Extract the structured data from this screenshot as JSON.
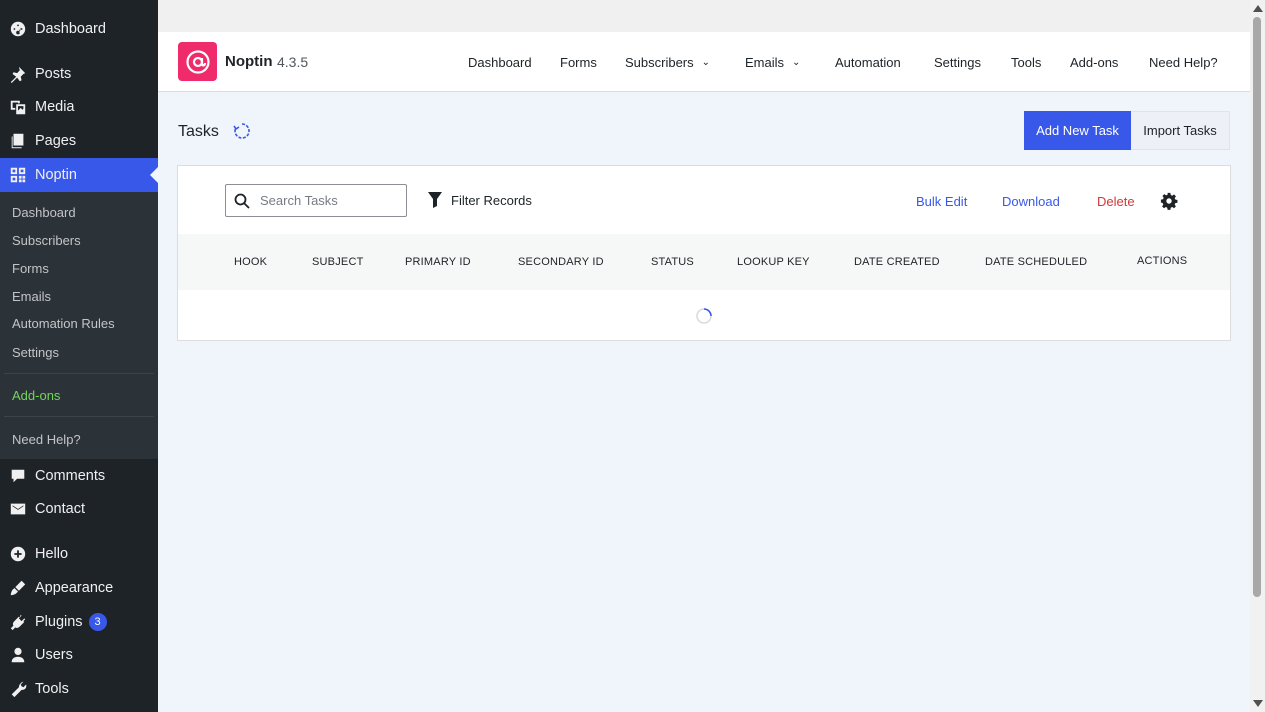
{
  "sidebar": {
    "top_items": [
      {
        "label": "Dashboard",
        "icon": "dashboard-icon"
      },
      {
        "label": "Posts",
        "icon": "pin-icon"
      },
      {
        "label": "Media",
        "icon": "media-icon"
      },
      {
        "label": "Pages",
        "icon": "pages-icon"
      },
      {
        "label": "Noptin",
        "icon": "grid-icon",
        "active": true
      }
    ],
    "submenu": {
      "dashboard": "Dashboard",
      "subscribers": "Subscribers",
      "forms": "Forms",
      "emails": "Emails",
      "automation_rules": "Automation Rules",
      "settings": "Settings",
      "addons": "Add-ons",
      "need_help": "Need Help?"
    },
    "bottom_items": [
      {
        "label": "Comments",
        "icon": "comment-icon"
      },
      {
        "label": "Contact",
        "icon": "mail-icon"
      },
      {
        "label": "Hello",
        "icon": "plus-circle-icon"
      },
      {
        "label": "Appearance",
        "icon": "brush-icon"
      },
      {
        "label": "Plugins",
        "icon": "plugin-icon",
        "badge": "3"
      },
      {
        "label": "Users",
        "icon": "user-icon"
      },
      {
        "label": "Tools",
        "icon": "wrench-icon"
      }
    ]
  },
  "header": {
    "brand": "Noptin",
    "version": "4.3.5",
    "nav": {
      "dashboard": "Dashboard",
      "forms": "Forms",
      "subscribers": "Subscribers",
      "emails": "Emails",
      "automation": "Automation",
      "settings": "Settings",
      "tools": "Tools",
      "addons": "Add-ons",
      "need_help": "Need Help?"
    }
  },
  "page": {
    "title": "Tasks",
    "add_new_label": "Add New Task",
    "import_label": "Import Tasks"
  },
  "toolbar": {
    "search_placeholder": "Search Tasks",
    "filter_label": "Filter Records",
    "bulk_edit": "Bulk Edit",
    "download": "Download",
    "delete": "Delete"
  },
  "table": {
    "columns": {
      "hook": "HOOK",
      "subject": "SUBJECT",
      "primary_id": "PRIMARY ID",
      "secondary_id": "SECONDARY ID",
      "status": "STATUS",
      "lookup_key": "LOOKUP KEY",
      "date_created": "DATE CREATED",
      "date_scheduled": "DATE SCHEDULED",
      "actions": "ACTIONS"
    },
    "loading": true
  },
  "colors": {
    "accent": "#3858e9",
    "brand": "#ef2b6b",
    "danger": "#d63638",
    "addons_green": "#71d65a",
    "sidebar_bg": "#1d2327"
  }
}
